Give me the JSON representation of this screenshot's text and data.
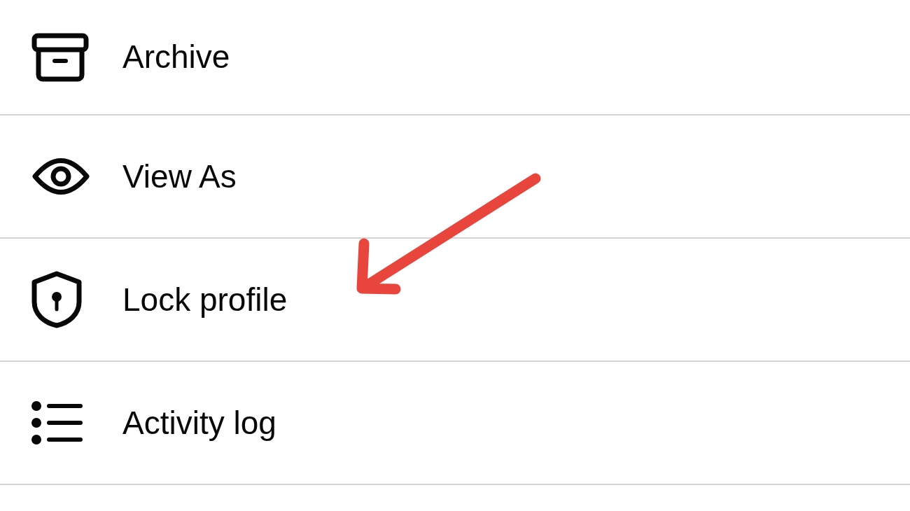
{
  "menu": {
    "items": [
      {
        "label": "Archive",
        "annotated": false
      },
      {
        "label": "View As",
        "annotated": false
      },
      {
        "label": "Lock profile",
        "annotated": true
      },
      {
        "label": "Activity log",
        "annotated": false
      }
    ]
  }
}
